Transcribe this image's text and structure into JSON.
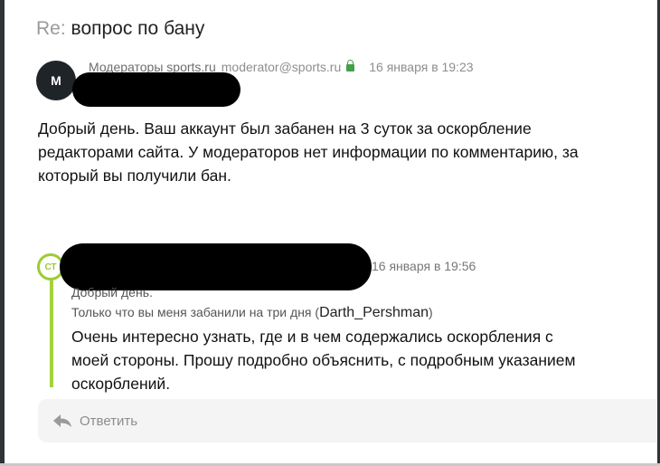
{
  "message": {
    "subject_prefix": "Re:",
    "subject_rest": " вопрос по бану",
    "avatar_letter": "M",
    "sender_name": "Модераторы sports.ru",
    "sender_email": "moderator@sports.ru",
    "date": "16 января в 19:23",
    "body_lines": [
      "Добрый день. Ваш аккаунт был забанен на 3 суток за оскорбление",
      "редакторами сайта. У модераторов нет информации по комментарию, за",
      "который вы получили бан."
    ]
  },
  "quoted": {
    "avatar_text": "СТ",
    "date": "16 января в 19:56",
    "line1": "Добрый день.",
    "line2_prefix": "Только что вы меня забанили на три дня (",
    "line2_nick": "Darth_Pershman",
    "line2_suffix": ")",
    "big_lines": [
      "Очень интересно узнать, где и в чем содержались оскорбления с",
      "моей стороны. Прошу подробно объяснить, с подробным указанием",
      "оскорблений."
    ]
  },
  "reply": {
    "label": "Ответить",
    "icon": "reply-arrow-icon"
  },
  "colors": {
    "quote_accent": "#a5d13b",
    "secure_lock": "#43a047",
    "avatar_bg": "#1f2428"
  }
}
